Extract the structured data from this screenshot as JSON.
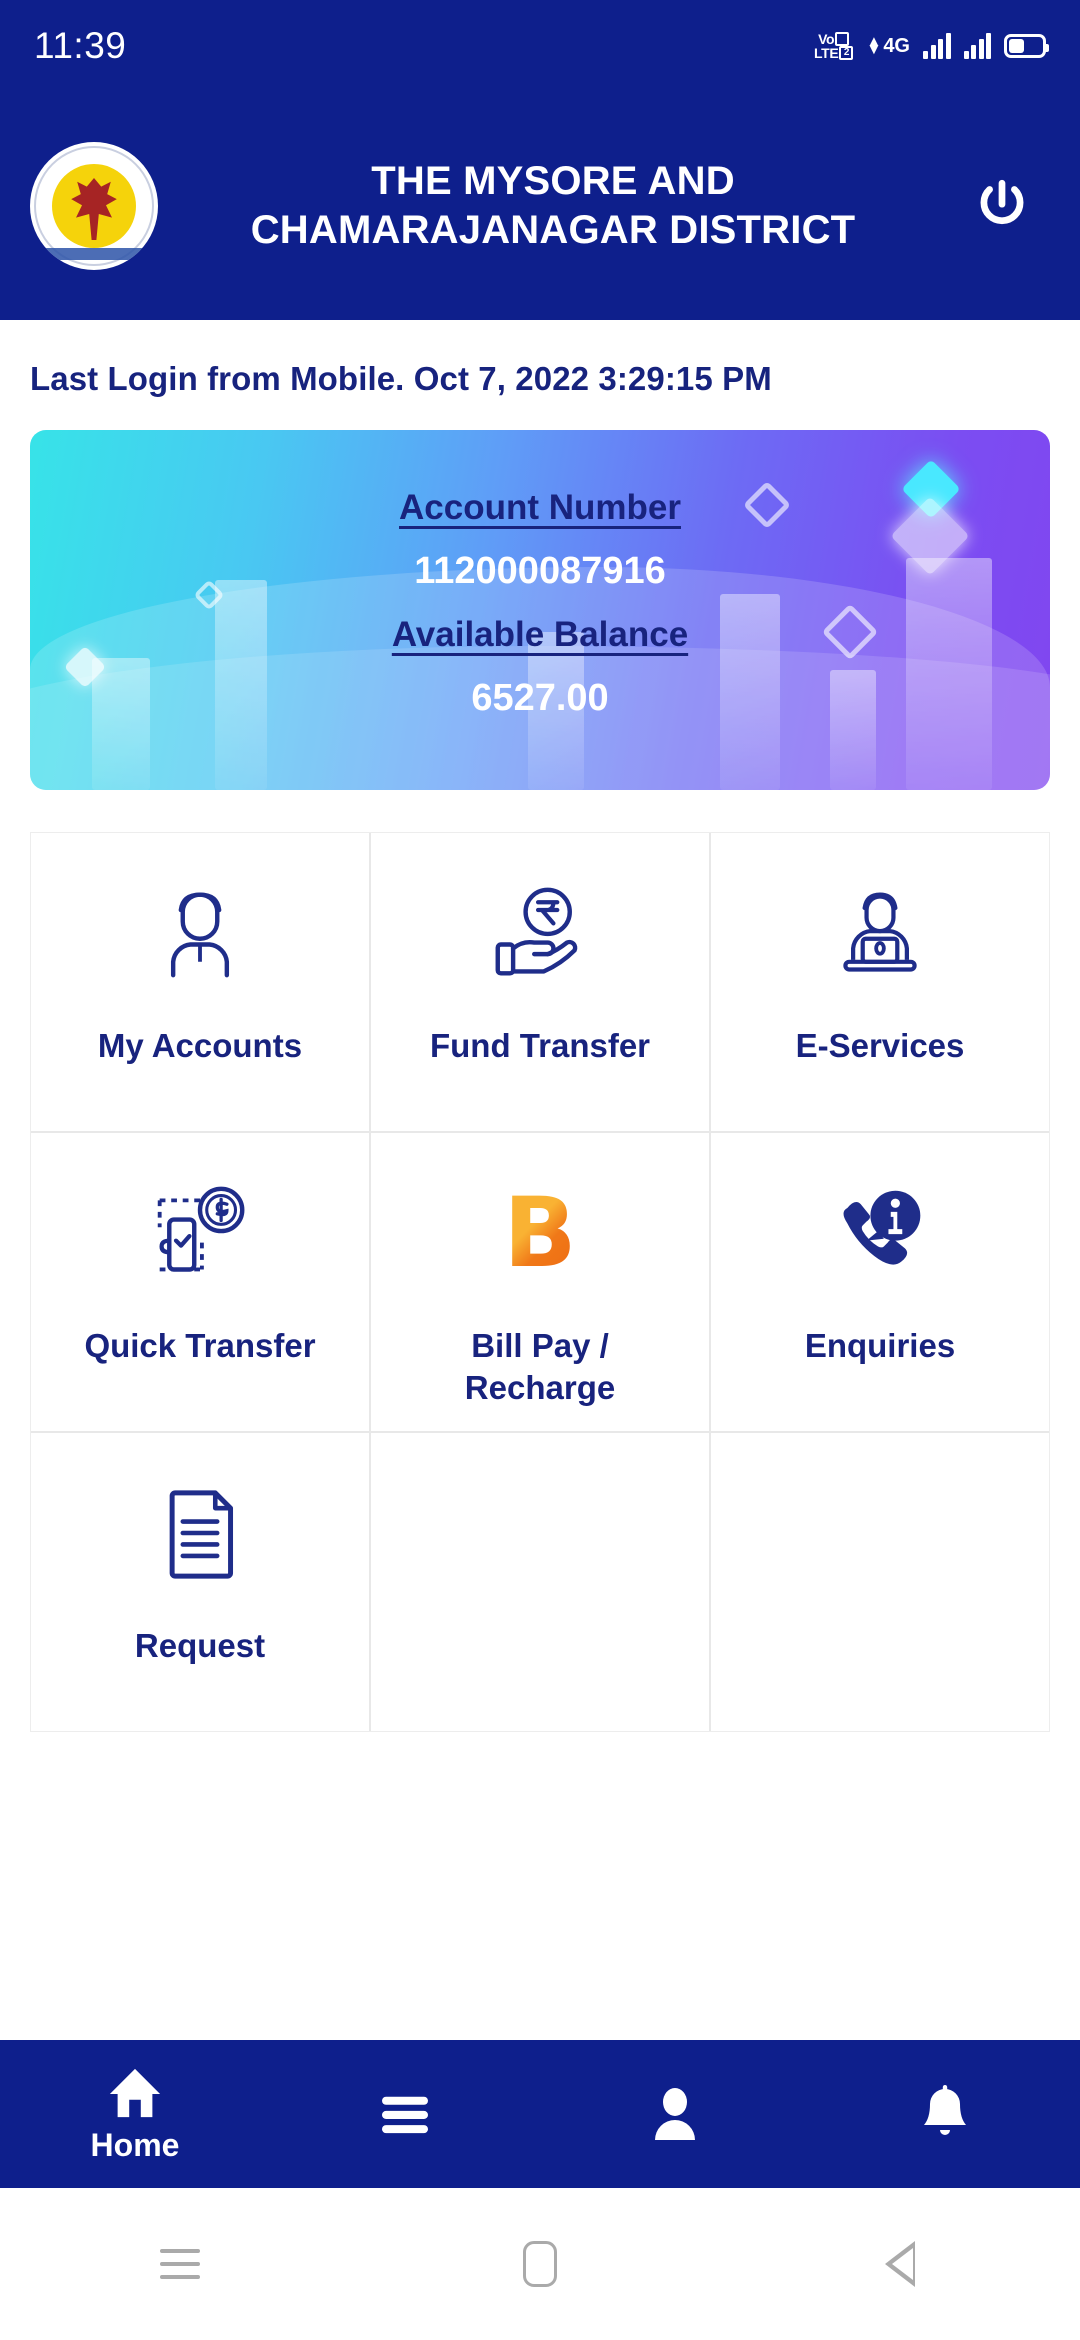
{
  "status_bar": {
    "clock": "11:39",
    "volte_label_top": "Vo",
    "volte_label_bottom": "LTE",
    "sim_badge": "2",
    "network": "4G",
    "arrows": "⇅"
  },
  "header": {
    "title_line1": "THE MYSORE AND",
    "title_line2": "CHAMARAJANAGAR DISTRICT",
    "logo_name": "bank-logo",
    "power_label": "Logout"
  },
  "last_login": "Last Login from Mobile. Oct 7, 2022 3:29:15 PM",
  "balance_card": {
    "account_number_label": "Account Number",
    "account_number": "112000087916",
    "available_balance_label": "Available Balance",
    "available_balance": "6527.00"
  },
  "tiles": [
    {
      "label": "My Accounts",
      "icon": "user-icon"
    },
    {
      "label": "Fund Transfer",
      "icon": "hand-rupee-icon"
    },
    {
      "label": "E-Services",
      "icon": "person-laptop-icon"
    },
    {
      "label": "Quick Transfer",
      "icon": "mobile-coin-icon"
    },
    {
      "label": "Bill Pay /\nRecharge",
      "icon": "bhim-logo-icon",
      "bhim_letter": "B"
    },
    {
      "label": "Enquiries",
      "icon": "phone-info-icon"
    },
    {
      "label": "Request",
      "icon": "document-icon"
    }
  ],
  "tile_labels": {
    "my_accounts": "My Accounts",
    "fund_transfer": "Fund Transfer",
    "e_services": "E-Services",
    "quick_transfer": "Quick Transfer",
    "bill_pay_line1": "Bill Pay /",
    "bill_pay_line2": "Recharge",
    "enquiries": "Enquiries",
    "request": "Request",
    "bhim_letter": "B"
  },
  "bottom_nav": {
    "home_label": "Home",
    "items": [
      "home-icon",
      "menu-icon",
      "profile-icon",
      "notifications-icon"
    ]
  },
  "system_nav": {
    "recents": "recents-button",
    "home": "home-button",
    "back": "back-button"
  },
  "colors": {
    "navy": "#0E1F8C",
    "text_navy": "#18237E",
    "card_start": "#37E3E8",
    "card_end": "#8146F0",
    "bhim_orange": "#F07818",
    "grid_line": "#E8E8E8"
  }
}
